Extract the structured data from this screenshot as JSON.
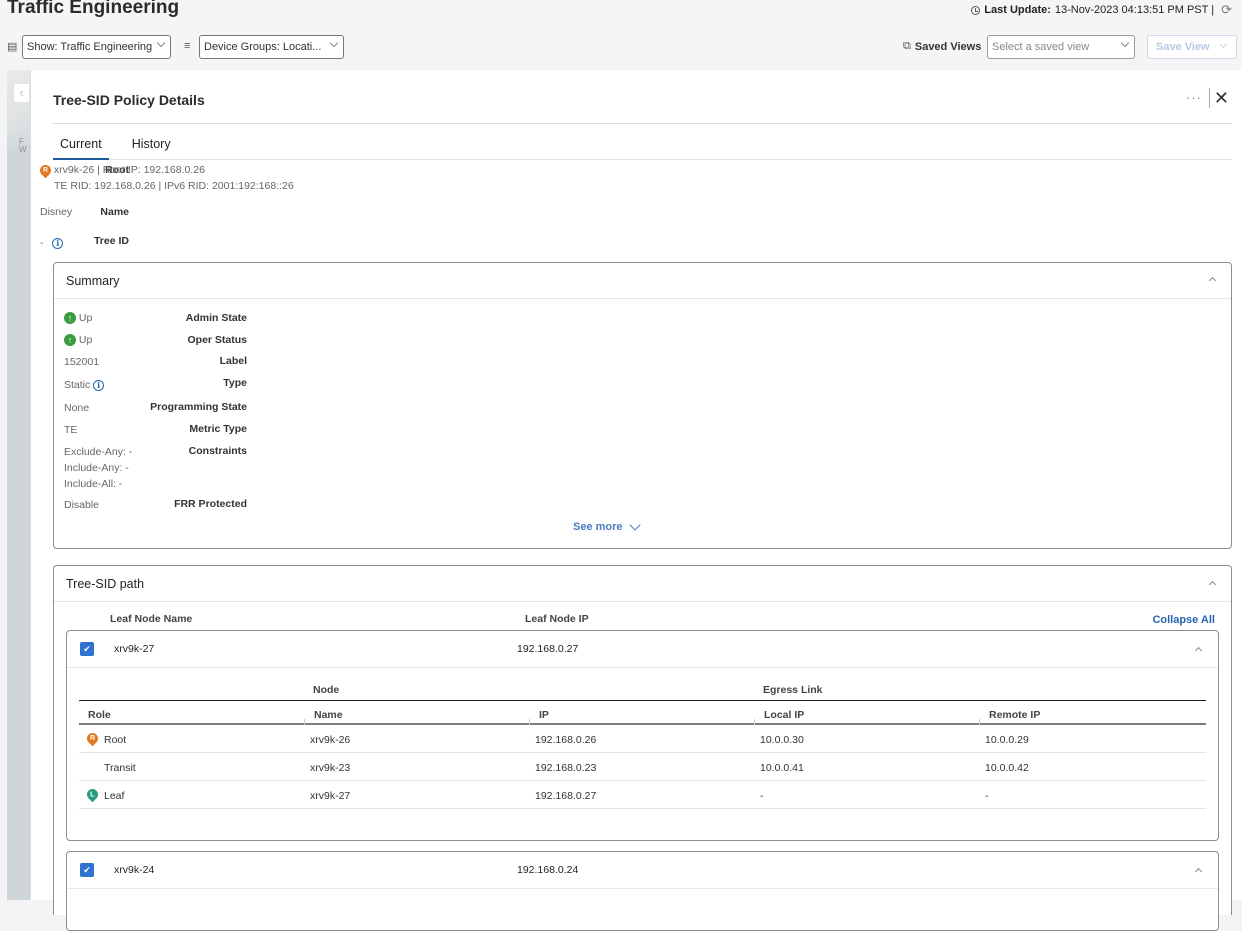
{
  "header": {
    "title": "Traffic Engineering",
    "last_update_label": "Last Update:",
    "last_update_value": "13-Nov-2023 04:13:51 PM PST |",
    "show_filter": "Show: Traffic Engineering",
    "device_groups_filter": "Device Groups: Locati...",
    "saved_views_label": "Saved Views",
    "saved_view_placeholder": "Select a saved view",
    "save_view_button": "Save View"
  },
  "map": {
    "text": "F\nW"
  },
  "panel": {
    "title": "Tree-SID Policy Details",
    "more_label": "···",
    "close_label": "✕",
    "tabs": [
      {
        "label": "Current",
        "active": true
      },
      {
        "label": "History",
        "active": false
      }
    ],
    "details": {
      "root_label": "Root",
      "root_badge": "R",
      "root_line1": "xrv9k-26 | Root IP: 192.168.0.26",
      "root_line2": "TE RID: 192.168.0.26 | IPv6 RID: 2001:192:168::26",
      "name_label": "Name",
      "name_value": "Disney",
      "tree_id_label": "Tree ID",
      "tree_id_value": "-"
    },
    "summary": {
      "title": "Summary",
      "fields": [
        {
          "label": "Admin State",
          "value": "Up",
          "icon": "up"
        },
        {
          "label": "Oper Status",
          "value": "Up",
          "icon": "up"
        },
        {
          "label": "Label",
          "value": "152001"
        },
        {
          "label": "Type",
          "value": "Static",
          "icon": "info"
        },
        {
          "label": "Programming State",
          "value": "None"
        },
        {
          "label": "Metric Type",
          "value": "TE"
        },
        {
          "label": "Constraints",
          "value": "Exclude-Any: -",
          "value2": "Include-Any: -",
          "value3": "Include-All: -"
        },
        {
          "label": "FRR Protected",
          "value": "Disable"
        }
      ],
      "see_more": "See more"
    },
    "path": {
      "title": "Tree-SID path",
      "col_leaf_name": "Leaf Node Name",
      "col_leaf_ip": "Leaf Node IP",
      "collapse_all": "Collapse All",
      "leaves": [
        {
          "name": "xrv9k-27",
          "ip": "192.168.0.27",
          "checked": true,
          "table": {
            "group_node": "Node",
            "group_egress": "Egress Link",
            "headers": [
              "Role",
              "Name",
              "IP",
              "Local IP",
              "Remote IP"
            ],
            "rows": [
              {
                "role": "Root",
                "badge": "R",
                "name": "xrv9k-26",
                "ip": "192.168.0.26",
                "local_ip": "10.0.0.30",
                "remote_ip": "10.0.0.29"
              },
              {
                "role": "Transit",
                "badge": "",
                "name": "xrv9k-23",
                "ip": "192.168.0.23",
                "local_ip": "10.0.0.41",
                "remote_ip": "10.0.0.42"
              },
              {
                "role": "Leaf",
                "badge": "L",
                "name": "xrv9k-27",
                "ip": "192.168.0.27",
                "local_ip": "-",
                "remote_ip": "-"
              }
            ]
          }
        },
        {
          "name": "xrv9k-24",
          "ip": "192.168.0.24",
          "checked": true
        }
      ]
    }
  },
  "colors": {
    "accent": "#2467b0",
    "checkbox": "#2f73d0",
    "root_pin": "#e0791d",
    "leaf_pin": "#2a9a80",
    "status_up": "#3c9a3f"
  }
}
